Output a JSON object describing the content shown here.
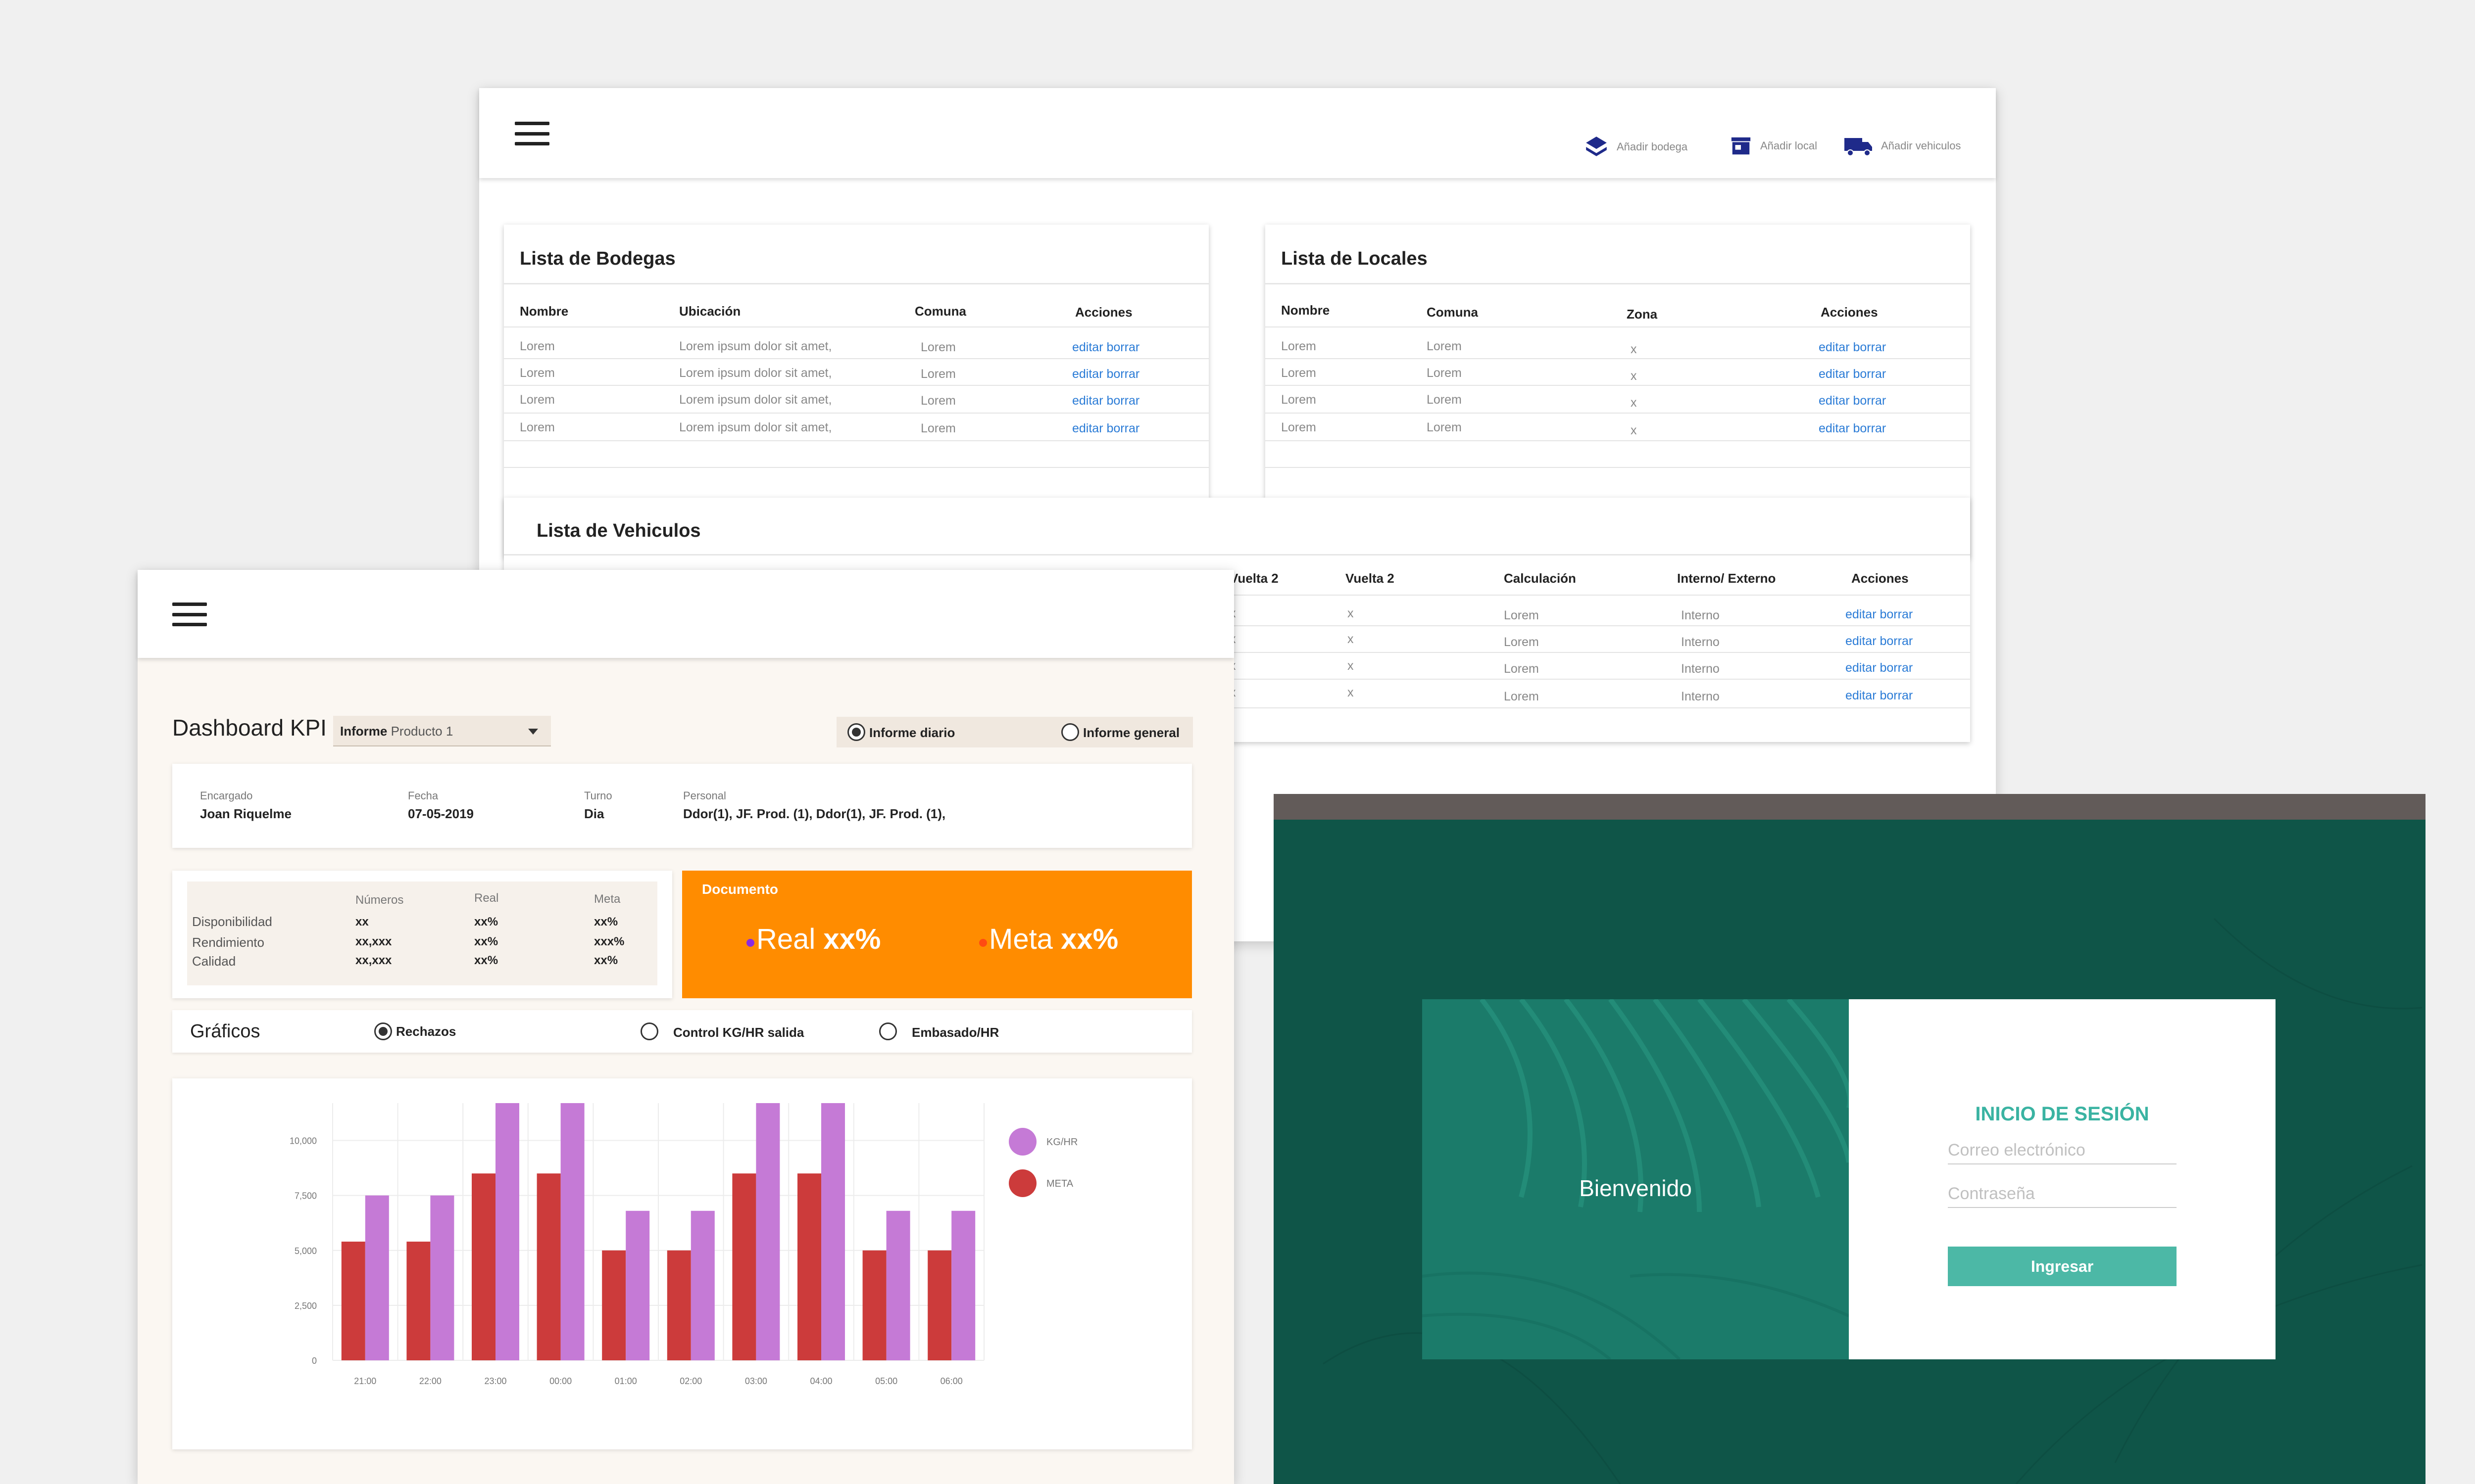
{
  "admin": {
    "toolbar": [
      {
        "label": "Añadir bodega",
        "icon": "layers-icon"
      },
      {
        "label": "Añadir local",
        "icon": "store-icon"
      },
      {
        "label": "Añadir vehiculos",
        "icon": "truck-icon"
      }
    ],
    "bodegas": {
      "title": "Lista de Bodegas",
      "headers": [
        "Nombre",
        "Ubicación",
        "Comuna",
        "Acciones"
      ],
      "rows": [
        [
          "Lorem",
          "Lorem ipsum dolor sit amet,",
          "Lorem",
          "editar borrar"
        ],
        [
          "Lorem",
          "Lorem ipsum dolor sit amet,",
          "Lorem",
          "editar borrar"
        ],
        [
          "Lorem",
          "Lorem ipsum dolor sit amet,",
          "Lorem",
          "editar borrar"
        ],
        [
          "Lorem",
          "Lorem ipsum dolor sit amet,",
          "Lorem",
          "editar borrar"
        ]
      ]
    },
    "locales": {
      "title": "Lista de Locales",
      "headers": [
        "Nombre",
        "Comuna",
        "Zona",
        "Acciones"
      ],
      "rows": [
        [
          "Lorem",
          "Lorem",
          "x",
          "editar borrar"
        ],
        [
          "Lorem",
          "Lorem",
          "x",
          "editar borrar"
        ],
        [
          "Lorem",
          "Lorem",
          "x",
          "editar borrar"
        ],
        [
          "Lorem",
          "Lorem",
          "x",
          "editar borrar"
        ]
      ]
    },
    "vehiculos": {
      "title": "Lista de Vehiculos",
      "headers": [
        "Vuelta 2",
        "Vuelta 2",
        "Calculación",
        "Interno/ Externo",
        "Acciones"
      ],
      "rows": [
        [
          "x",
          "x",
          "Lorem",
          "Interno",
          "editar borrar"
        ],
        [
          "x",
          "x",
          "Lorem",
          "Interno",
          "editar borrar"
        ],
        [
          "x",
          "x",
          "Lorem",
          "Interno",
          "editar borrar"
        ],
        [
          "x",
          "x",
          "Lorem",
          "Interno",
          "editar borrar"
        ]
      ]
    }
  },
  "dashboard": {
    "title": "Dashboard KPI",
    "select_label": "Informe",
    "select_value": "Producto 1",
    "report_options": [
      "Informe diario",
      "Informe general"
    ],
    "report_selected": "Informe diario",
    "info": [
      {
        "label": "Encargado",
        "value": "Joan Riquelme"
      },
      {
        "label": "Fecha",
        "value": "07-05-2019"
      },
      {
        "label": "Turno",
        "value": "Dia"
      },
      {
        "label": "Personal",
        "value": "Ddor(1), JF. Prod. (1), Ddor(1), JF. Prod. (1),"
      }
    ],
    "kpi_headers": [
      "Números",
      "Real",
      "Meta"
    ],
    "kpi_rows": [
      {
        "name": "Disponibilidad",
        "numeros": "xx",
        "real": "xx%",
        "meta": "xx%"
      },
      {
        "name": "Rendimiento",
        "numeros": "xx,xxx",
        "real": "xx%",
        "meta": "xxx%"
      },
      {
        "name": "Calidad",
        "numeros": "xx,xxx",
        "real": "xx%",
        "meta": "xx%"
      }
    ],
    "documento": {
      "title": "Documento",
      "real_label": "Real",
      "real_value": "xx%",
      "meta_label": "Meta",
      "meta_value": "xx%"
    },
    "graficos": {
      "title": "Gráficos",
      "options": [
        "Rechazos",
        "Control KG/HR salida",
        "Embasado/HR"
      ],
      "selected": "Rechazos"
    }
  },
  "chart_data": {
    "type": "bar",
    "categories": [
      "21:00",
      "22:00",
      "23:00",
      "00:00",
      "01:00",
      "02:00",
      "03:00",
      "04:00",
      "05:00",
      "06:00"
    ],
    "series": [
      {
        "name": "META",
        "color": "#cc3b3b",
        "values": [
          5400,
          5400,
          8500,
          8500,
          5000,
          5000,
          8500,
          8500,
          5000,
          5000
        ]
      },
      {
        "name": "KG/HR",
        "color": "#c57ad6",
        "values": [
          7500,
          7500,
          11700,
          11700,
          6800,
          6800,
          11700,
          11700,
          6800,
          6800
        ]
      }
    ],
    "yticks": [
      0,
      2500,
      5000,
      7500,
      10000
    ],
    "ytick_labels": [
      "0",
      "2,500",
      "5,000",
      "7,500",
      "10,000"
    ],
    "ylim": [
      0,
      11700
    ],
    "legend": [
      "KG/HR",
      "META"
    ],
    "legend_position": "top-right"
  },
  "login": {
    "welcome": "Bienvenido",
    "title": "INICIO DE SESIÓN",
    "email_placeholder": "Correo electrónico",
    "password_placeholder": "Contraseña",
    "submit_label": "Ingresar"
  }
}
